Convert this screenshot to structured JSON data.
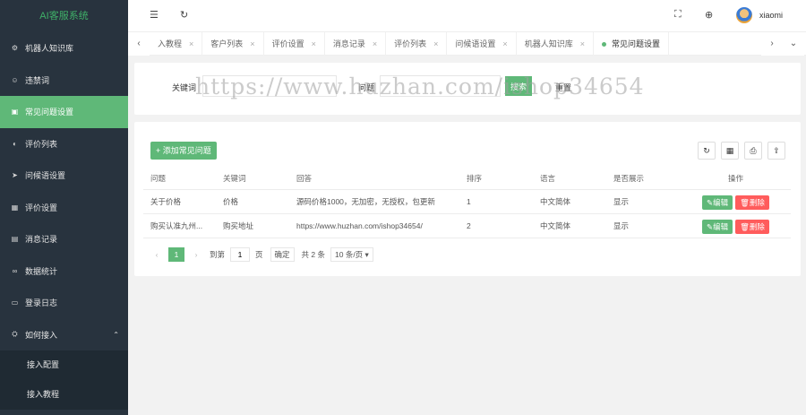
{
  "app": {
    "title": "AI客服系统"
  },
  "sidebar": {
    "items": [
      {
        "label": "机器人知识库",
        "icon": "robot-icon",
        "glyph": "⚙"
      },
      {
        "label": "违禁词",
        "icon": "forbidden-icon",
        "glyph": "☺"
      },
      {
        "label": "常见问题设置",
        "icon": "faq-icon",
        "glyph": "▣",
        "active": true
      },
      {
        "label": "评价列表",
        "icon": "rating-list-icon",
        "glyph": "◐"
      },
      {
        "label": "问候语设置",
        "icon": "send-icon",
        "glyph": "➤"
      },
      {
        "label": "评价设置",
        "icon": "calendar-icon",
        "glyph": "▦"
      },
      {
        "label": "消息记录",
        "icon": "message-icon",
        "glyph": "▤"
      },
      {
        "label": "数据统计",
        "icon": "stats-icon",
        "glyph": "∞"
      },
      {
        "label": "登录日志",
        "icon": "log-icon",
        "glyph": "▭"
      },
      {
        "label": "如何接入",
        "icon": "access-icon",
        "glyph": "⛭"
      }
    ],
    "submenu": [
      {
        "label": "接入配置"
      },
      {
        "label": "接入教程"
      }
    ]
  },
  "header": {
    "menu_icon": "☰",
    "refresh_icon": "↻",
    "fullscreen_icon": "⛶",
    "globe_icon": "⊕",
    "username": "xiaomi"
  },
  "tabs": [
    {
      "label": "入教程"
    },
    {
      "label": "客户列表"
    },
    {
      "label": "评价设置"
    },
    {
      "label": "消息记录"
    },
    {
      "label": "评价列表"
    },
    {
      "label": "问候语设置"
    },
    {
      "label": "机器人知识库"
    },
    {
      "label": "常见问题设置",
      "active": true
    }
  ],
  "tab_close": "×",
  "search": {
    "keyword_label": "关键词",
    "question_label": "问题",
    "search_button": "搜索",
    "reset_button": "重置",
    "keyword_value": "",
    "question_value": ""
  },
  "table": {
    "add_button": "+ 添加常见问题",
    "tools": [
      "↻",
      "▦",
      "⎙",
      "⇪"
    ],
    "columns": [
      "问题",
      "关键词",
      "回答",
      "排序",
      "语言",
      "是否展示",
      "操作"
    ],
    "rows": [
      {
        "question": "关于价格",
        "keyword": "价格",
        "answer": "源码价格1000，无加密，无授权，包更新",
        "sort": "1",
        "lang": "中文简体",
        "show": "显示"
      },
      {
        "question": "购买认准九州...",
        "keyword": "购买地址",
        "answer": "https://www.huzhan.com/ishop34654/",
        "sort": "2",
        "lang": "中文简体",
        "show": "显示"
      }
    ],
    "edit_label": "✎编辑",
    "delete_label": "🗑删除"
  },
  "pager": {
    "prev": "‹",
    "next": "›",
    "current": "1",
    "goto_label": "到第",
    "page_input": "1",
    "page_unit": "页",
    "confirm": "确定",
    "total": "共 2 条",
    "per_page": "10 条/页 ▾"
  },
  "watermark": "https://www.huzhan.com/ishop34654"
}
